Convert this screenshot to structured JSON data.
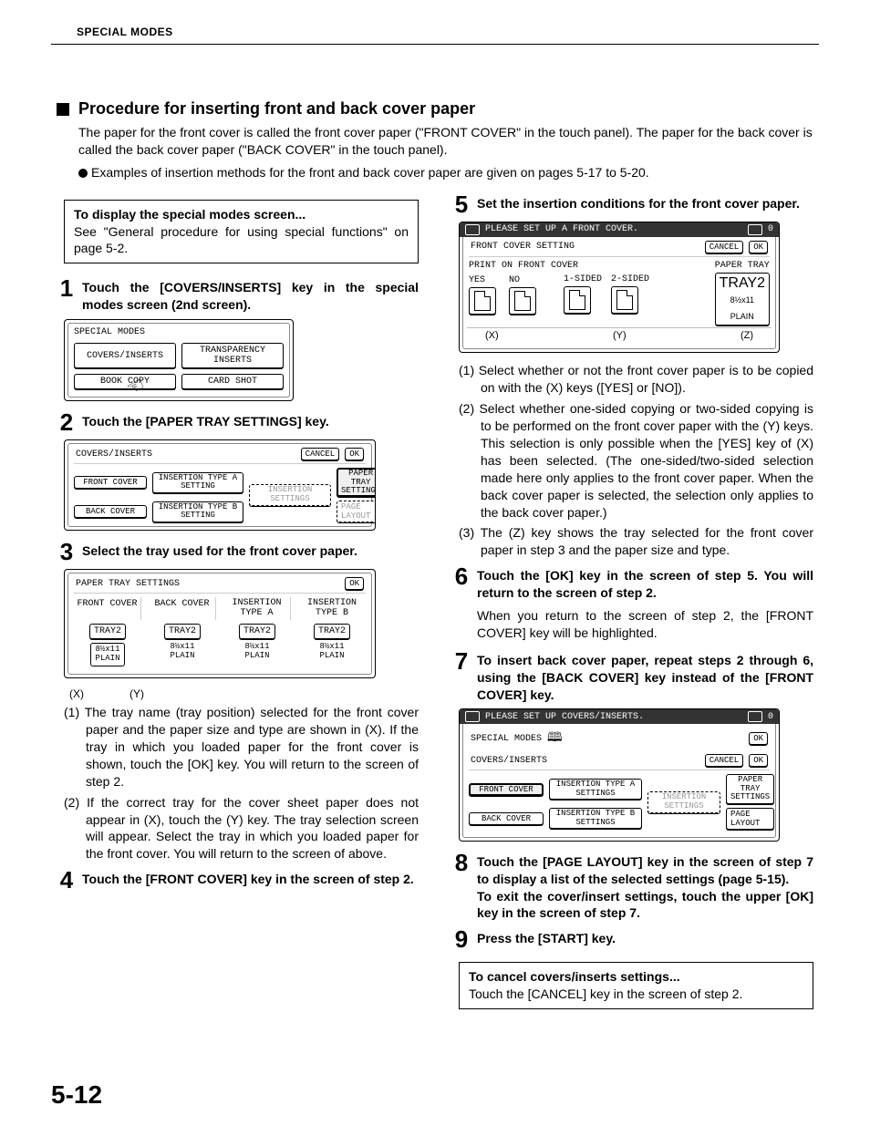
{
  "header": "SPECIAL MODES",
  "page_number": "5-12",
  "section_title": "Procedure for inserting front and back cover paper",
  "intro_line1": "The paper for the front cover is called the front cover paper (\"FRONT COVER\" in the touch panel). The paper for the back cover is called the back cover paper (\"BACK COVER\" in the touch panel).",
  "intro_line2": "Examples of insertion methods for the front and back cover paper are given on pages 5-17 to 5-20.",
  "callout1_title": "To display the special modes screen...",
  "callout1_body": "See \"General procedure for using special functions\" on page 5-2.",
  "steps": {
    "s1": "Touch the [COVERS/INSERTS] key in the special modes screen (2nd screen).",
    "s2": "Touch the [PAPER TRAY SETTINGS] key.",
    "s3": "Select the tray used for the front cover paper.",
    "s3_notes": {
      "n1": "(1) The tray name (tray position) selected for the front cover paper and the paper size and type are shown in  (X).  If the tray in which  you loaded paper for the front cover is shown, touch the [OK] key. You will return to the screen of step 2.",
      "n2": "(2) If the correct tray for the cover sheet paper does not appear in  (X), touch the (Y) key. The tray selection screen will appear. Select the tray in which you loaded paper for the front cover. You will return to the screen of above."
    },
    "s4": "Touch the [FRONT COVER] key in the screen of step 2.",
    "s5": "Set the insertion conditions for the front cover paper.",
    "s5_notes": {
      "n1": "(1) Select whether or not the front cover paper is to be copied on with the (X) keys ([YES] or [NO]).",
      "n2": "(2) Select whether one-sided copying or two-sided copying is to be performed on the front cover paper with the (Y) keys. This selection is only possible when the [YES] key of (X) has been selected. (The one-sided/two-sided selection made here only applies to the front cover paper. When the back cover paper is selected, the selection only applies to the back cover paper.)",
      "n3": "(3) The (Z) key shows the tray selected for the front cover paper in step 3 and the paper size and type."
    },
    "s6": "Touch the [OK] key in the screen of step 5. You will return to the screen of step 2.",
    "s6_sub": "When you return to the screen of step 2, the [FRONT COVER] key will be highlighted.",
    "s7": "To insert back cover paper, repeat steps 2 through 6, using the [BACK COVER] key instead of the [FRONT COVER] key.",
    "s8": "Touch the [PAGE LAYOUT] key in the screen of step 7 to display a list of the selected settings (page 5-15).\nTo exit the cover/insert settings, touch the upper [OK] key in the screen of step 7.",
    "s9": "Press the [START] key."
  },
  "cancel_title": "To cancel covers/inserts settings...",
  "cancel_body": "Touch the [CANCEL] key in the screen of step 2.",
  "panel1": {
    "title": "SPECIAL MODES",
    "btns": [
      "COVERS/INSERTS",
      "TRANSPARENCY INSERTS",
      "BOOK COPY",
      "CARD SHOT"
    ]
  },
  "panel2": {
    "title": "COVERS/INSERTS",
    "cancel": "CANCEL",
    "ok": "OK",
    "front": "FRONT COVER",
    "back": "BACK COVER",
    "insA": "INSERTION TYPE A SETTING",
    "insB": "INSERTION TYPE B SETTING",
    "insSet": "INSERTION SETTINGS",
    "ptray": "PAPER TRAY SETTINGS",
    "layout": "PAGE LAYOUT"
  },
  "panel3": {
    "title": "PAPER TRAY SETTINGS",
    "ok": "OK",
    "cols": [
      "FRONT COVER",
      "BACK COVER",
      "INSERTION TYPE A",
      "INSERTION TYPE B"
    ],
    "tray": "TRAY2",
    "size": "8½x11",
    "type": "PLAIN",
    "axisX": "(X)",
    "axisY": "(Y)"
  },
  "panel5": {
    "topbar": "PLEASE SET UP A FRONT COVER.",
    "count": "0",
    "row_title": "FRONT COVER SETTING",
    "cancel": "CANCEL",
    "ok": "OK",
    "print_label": "PRINT ON FRONT COVER",
    "paper_tray": "PAPER TRAY",
    "yes": "YES",
    "no": "NO",
    "one": "1-SIDED",
    "two": "2-SIDED",
    "tray": "TRAY2",
    "size": "8½x11",
    "type": "PLAIN",
    "axisX": "(X)",
    "axisY": "(Y)",
    "axisZ": "(Z)"
  },
  "panel7": {
    "topbar": "PLEASE SET UP COVERS/INSERTS.",
    "count": "0",
    "special": "SPECIAL MODES",
    "ok": "OK",
    "ci": "COVERS/INSERTS",
    "cancel": "CANCEL",
    "front": "FRONT COVER",
    "back": "BACK COVER",
    "insA": "INSERTION TYPE A SETTINGS",
    "insB": "INSERTION TYPE B SETTINGS",
    "insSet": "INSERTION SETTINGS",
    "ptray": "PAPER TRAY SETTINGS",
    "layout": "PAGE LAYOUT"
  }
}
